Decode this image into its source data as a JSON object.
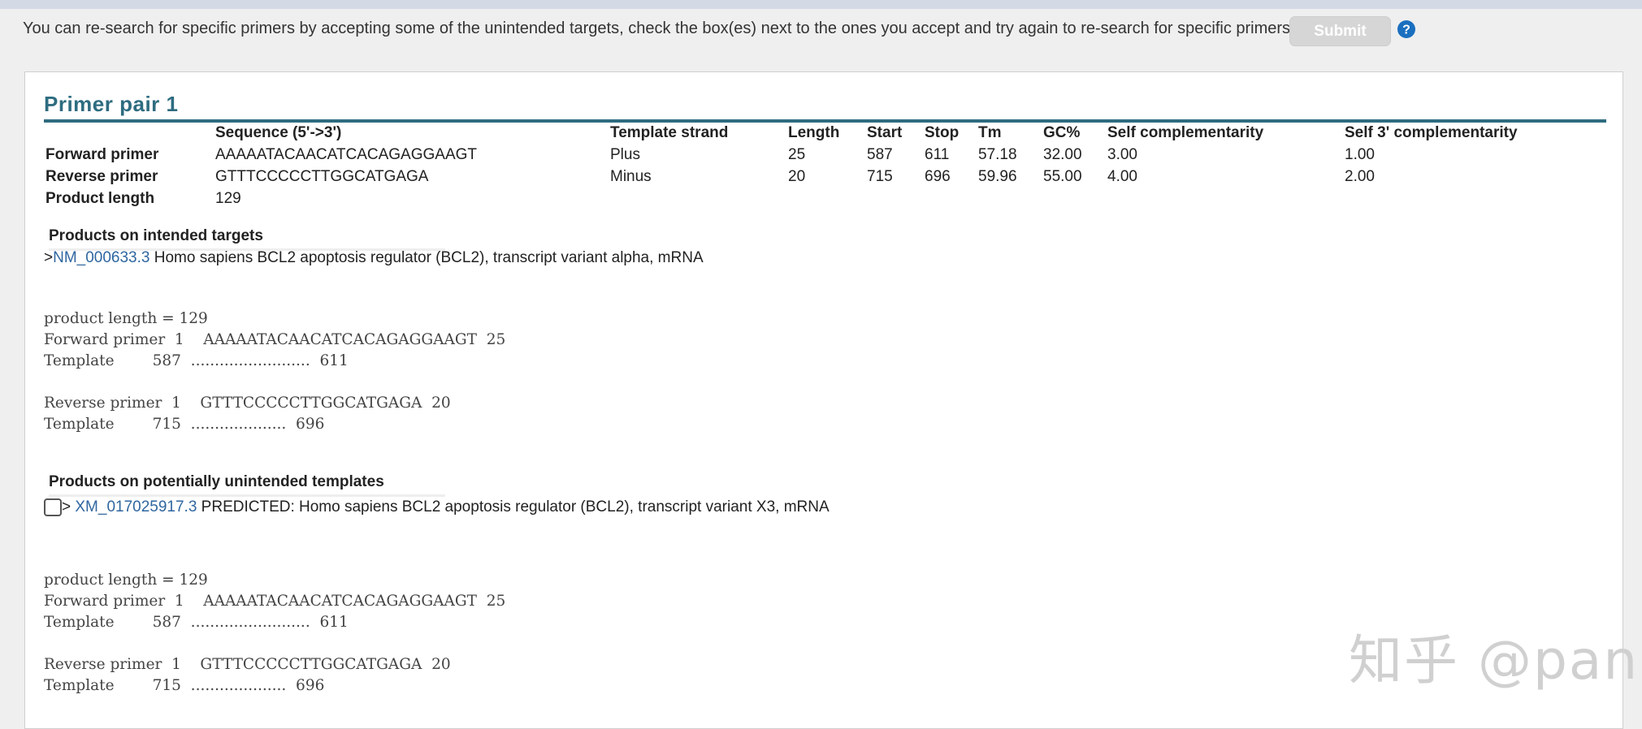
{
  "instruction_text": "You can re-search for specific primers by accepting some of the unintended targets, check the box(es) next to the ones you accept and try again to re-search for specific primers",
  "submit_label": "Submit",
  "primer_pair_title": "Primer pair 1",
  "primer_table": {
    "headers": {
      "sequence": "Sequence (5'->3')",
      "strand": "Template strand",
      "length": "Length",
      "start": "Start",
      "stop": "Stop",
      "tm": "Tm",
      "gc": "GC%",
      "self_comp": "Self complementarity",
      "self3_comp": "Self 3' complementarity"
    },
    "forward": {
      "label": "Forward primer",
      "sequence": "AAAAATACAACATCACAGAGGAAGT",
      "strand": "Plus",
      "length": "25",
      "start": "587",
      "stop": "611",
      "tm": "57.18",
      "gc": "32.00",
      "self_comp": "3.00",
      "self3_comp": "1.00"
    },
    "reverse": {
      "label": "Reverse primer",
      "sequence": "GTTTCCCCCTTGGCATGAGA",
      "strand": "Minus",
      "length": "20",
      "start": "715",
      "stop": "696",
      "tm": "59.96",
      "gc": "55.00",
      "self_comp": "4.00",
      "self3_comp": "2.00"
    },
    "product": {
      "label": "Product length",
      "value": "129"
    }
  },
  "intended": {
    "heading": "Products on intended targets",
    "prefix": ">",
    "accession": "NM_000633.3",
    "description": " Homo sapiens BCL2 apoptosis regulator (BCL2), transcript variant alpha, mRNA",
    "alignment": "product length = 129\nForward primer  1    AAAAATACAACATCACAGAGGAAGT  25\nTemplate        587  .........................  611\n\nReverse primer  1    GTTTCCCCCTTGGCATGAGA  20\nTemplate        715  ....................  696"
  },
  "unintended": {
    "heading": "Products on potentially unintended templates",
    "prefix": "> ",
    "accession": "XM_017025917.3",
    "description": " PREDICTED: Homo sapiens BCL2 apoptosis regulator (BCL2), transcript variant X3, mRNA",
    "alignment": "product length = 129\nForward primer  1    AAAAATACAACATCACAGAGGAAGT  25\nTemplate        587  .........................  611\n\nReverse primer  1    GTTTCCCCCTTGGCATGAGA  20\nTemplate        715  ....................  696"
  },
  "watermark": "知乎 @pan",
  "colors": {
    "title": "#2e6c80",
    "link": "#2f66a0",
    "help_icon": "#1a6fbf",
    "submit_disabled": "#d6d6d6"
  }
}
